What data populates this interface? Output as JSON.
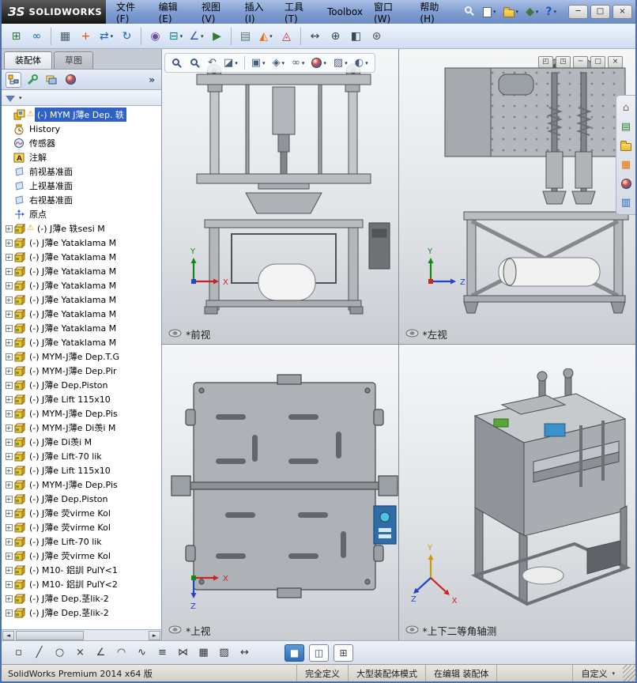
{
  "window": {
    "logo_mark": "ЗS",
    "logo_text": "SOLIDWORKS",
    "controls": [
      {
        "name": "minimize",
        "glyph": "─"
      },
      {
        "name": "maximize",
        "glyph": "□"
      },
      {
        "name": "close",
        "glyph": "×"
      }
    ]
  },
  "menubar": {
    "items": [
      {
        "name": "file",
        "label": "文件(F)"
      },
      {
        "name": "edit",
        "label": "编辑(E)"
      },
      {
        "name": "view",
        "label": "视图(V)"
      },
      {
        "name": "insert",
        "label": "插入(I)"
      },
      {
        "name": "tools",
        "label": "工具(T)"
      },
      {
        "name": "toolbox",
        "label": "Toolbox"
      },
      {
        "name": "window",
        "label": "窗口(W)"
      },
      {
        "name": "help",
        "label": "帮助(H)"
      }
    ]
  },
  "quick_access": [
    {
      "n": "new-document",
      "dd": true
    },
    {
      "n": "open-document",
      "dd": true
    },
    {
      "n": "options",
      "dd": true
    },
    {
      "n": "help",
      "dd": true
    }
  ],
  "toolbar": {
    "icons": [
      "insert-component",
      {
        "n": "mate"
      },
      "|",
      {
        "n": "linear-pattern"
      },
      {
        "n": "smart-fasteners"
      },
      {
        "n": "move-component",
        "dd": true
      },
      {
        "n": "rotate-component"
      },
      "|",
      {
        "n": "show-hidden-components"
      },
      {
        "n": "assembly-features",
        "dd": true
      },
      {
        "n": "reference-geometry",
        "dd": true
      },
      {
        "n": "motion-study"
      },
      "|",
      {
        "n": "bill-of-materials"
      },
      {
        "n": "exploded-view",
        "dd": true
      },
      {
        "n": "interference-detection"
      },
      "|",
      {
        "n": "measure"
      },
      {
        "n": "mass-properties"
      },
      {
        "n": "section-properties"
      },
      {
        "n": "options-gear"
      }
    ]
  },
  "left_panel": {
    "tabs": [
      {
        "name": "assembly",
        "label": "装配体",
        "active": true
      },
      {
        "name": "sketch",
        "label": "草图",
        "active": false
      }
    ],
    "manager_tabs": [
      "featuremanager",
      "propertymanager",
      "configurationmanager",
      "displaymanager"
    ],
    "expand_chevron": "»",
    "tree": {
      "items": [
        {
          "t": "(-) MYM J薄e Dep. 轶",
          "ic": "assembly-root",
          "sel": true,
          "warn": true
        },
        {
          "t": "History",
          "ic": "history"
        },
        {
          "t": "传感器",
          "ic": "sensors"
        },
        {
          "t": "注解",
          "ic": "annotations"
        },
        {
          "t": "前视基准面",
          "ic": "plane"
        },
        {
          "t": "上视基准面",
          "ic": "plane"
        },
        {
          "t": "右视基准面",
          "ic": "plane"
        },
        {
          "t": "原点",
          "ic": "origin"
        },
        {
          "t": "(-) J薄e 轶sesi M",
          "ic": "component",
          "exp": true,
          "warn": true
        },
        {
          "t": "(-) J薄e Yataklama M",
          "ic": "component",
          "exp": true
        },
        {
          "t": "(-) J薄e Yataklama M",
          "ic": "component",
          "exp": true
        },
        {
          "t": "(-) J薄e Yataklama M",
          "ic": "component",
          "exp": true
        },
        {
          "t": "(-) J薄e Yataklama M",
          "ic": "component",
          "exp": true
        },
        {
          "t": "(-) J薄e Yataklama M",
          "ic": "component",
          "exp": true
        },
        {
          "t": "(-) J薄e Yataklama M",
          "ic": "component",
          "exp": true
        },
        {
          "t": "(-) J薄e Yataklama M",
          "ic": "component",
          "exp": true
        },
        {
          "t": "(-) J薄e Yataklama M",
          "ic": "component",
          "exp": true
        },
        {
          "t": "(-) MYM-J薄e Dep.T.G",
          "ic": "component",
          "exp": true
        },
        {
          "t": "(-) MYM-J薄e Dep.Pir",
          "ic": "component",
          "exp": true
        },
        {
          "t": "(-) J薄e Dep.Piston",
          "ic": "component",
          "exp": true
        },
        {
          "t": "(-) J薄e Lift 115x10",
          "ic": "component",
          "exp": true
        },
        {
          "t": "(-) MYM-J薄e Dep.Pis",
          "ic": "component",
          "exp": true
        },
        {
          "t": "(-) MYM-J薄e Di羡i M",
          "ic": "component",
          "exp": true
        },
        {
          "t": "(-) J薄e Di羡i M",
          "ic": "component",
          "exp": true
        },
        {
          "t": "(-) J薄e Lift-70 lik",
          "ic": "component",
          "exp": true
        },
        {
          "t": "(-) J薄e Lift 115x10",
          "ic": "component",
          "exp": true
        },
        {
          "t": "(-) MYM-J薄e Dep.Pis",
          "ic": "component",
          "exp": true
        },
        {
          "t": "(-) J薄e Dep.Piston",
          "ic": "component",
          "exp": true
        },
        {
          "t": "(-) J薄e 荧virme Kol",
          "ic": "component",
          "exp": true
        },
        {
          "t": "(-) J薄e 荧virme Kol",
          "ic": "component",
          "exp": true
        },
        {
          "t": "(-) J薄e Lift-70 lik",
          "ic": "component",
          "exp": true
        },
        {
          "t": "(-) J薄e 荧virme Kol",
          "ic": "component",
          "exp": true
        },
        {
          "t": "(-) M10- 鋁訓 PulY<1",
          "ic": "component",
          "exp": true
        },
        {
          "t": "(-) M10- 鋁訓 PulY<2",
          "ic": "component",
          "exp": true
        },
        {
          "t": "(-) J薄e Dep.茎lik-2",
          "ic": "component",
          "exp": true
        },
        {
          "t": "(-) J薄e Dep.茎lik-2",
          "ic": "component",
          "exp": true
        }
      ]
    }
  },
  "graphics": {
    "headsup": [
      {
        "n": "zoom-fit"
      },
      {
        "n": "zoom-area"
      },
      {
        "n": "previous-view"
      },
      {
        "n": "section-view",
        "dd": true
      },
      {
        "n": "|"
      },
      {
        "n": "view-orientation",
        "dd": true
      },
      {
        "n": "display-style",
        "dd": true
      },
      {
        "n": "hide-show-items",
        "dd": true
      },
      {
        "n": "edit-appearance",
        "dd": true
      },
      {
        "n": "apply-scene",
        "dd": true
      },
      {
        "n": "view-settings",
        "dd": true
      }
    ],
    "window_buttons": [
      {
        "name": "pane-left",
        "glyph": "◰"
      },
      {
        "name": "pane-right",
        "glyph": "◳"
      },
      {
        "name": "minimize",
        "glyph": "─"
      },
      {
        "name": "restore",
        "glyph": "□"
      },
      {
        "name": "close",
        "glyph": "×"
      }
    ],
    "task_pane": [
      "home",
      "design-library",
      "file-explorer",
      "view-palette",
      "appearances",
      "custom-properties"
    ],
    "views": [
      {
        "name": "front",
        "label": "*前视",
        "axes": [
          {
            "l": "Y",
            "d": "up",
            "c": "#118811"
          },
          {
            "l": "X",
            "d": "right",
            "c": "#cc2222"
          }
        ],
        "dot": "#2244cc"
      },
      {
        "name": "left",
        "label": "*左视",
        "axes": [
          {
            "l": "Y",
            "d": "up",
            "c": "#118811"
          },
          {
            "l": "Z",
            "d": "right",
            "c": "#2244cc"
          }
        ],
        "dot": "#cc2222"
      },
      {
        "name": "top",
        "label": "*上视",
        "axes": [
          {
            "l": "X",
            "d": "right",
            "c": "#cc2222"
          },
          {
            "l": "Z",
            "d": "down",
            "c": "#2244cc"
          }
        ],
        "dot": "#118811"
      },
      {
        "name": "isometric",
        "label": "*上下二等角轴测",
        "axes": [
          {
            "l": "Y",
            "d": "up",
            "c": "#cc9900"
          },
          {
            "l": "X",
            "d": "dr",
            "c": "#cc2222"
          },
          {
            "l": "Z",
            "d": "dl",
            "c": "#2244cc"
          }
        ],
        "dot": null
      }
    ]
  },
  "bottom_toolbar": {
    "icons": [
      "select-point",
      "line",
      "circle",
      "delete-cross",
      "corner",
      "arc",
      "spline",
      "offset",
      "mirror",
      "pattern",
      "hatch",
      "dimension"
    ],
    "pane_buttons": [
      {
        "name": "viewport-single",
        "active": true
      },
      {
        "name": "viewport-two",
        "active": false
      },
      {
        "name": "viewport-four",
        "active": false
      }
    ]
  },
  "status_bar": {
    "left": "SolidWorks Premium 2014 x64 版",
    "segments": [
      {
        "label": "完全定义"
      },
      {
        "label": "大型装配体模式"
      },
      {
        "label": "在编辑 装配体"
      },
      {
        "label": "自定义",
        "dd": true
      }
    ]
  }
}
